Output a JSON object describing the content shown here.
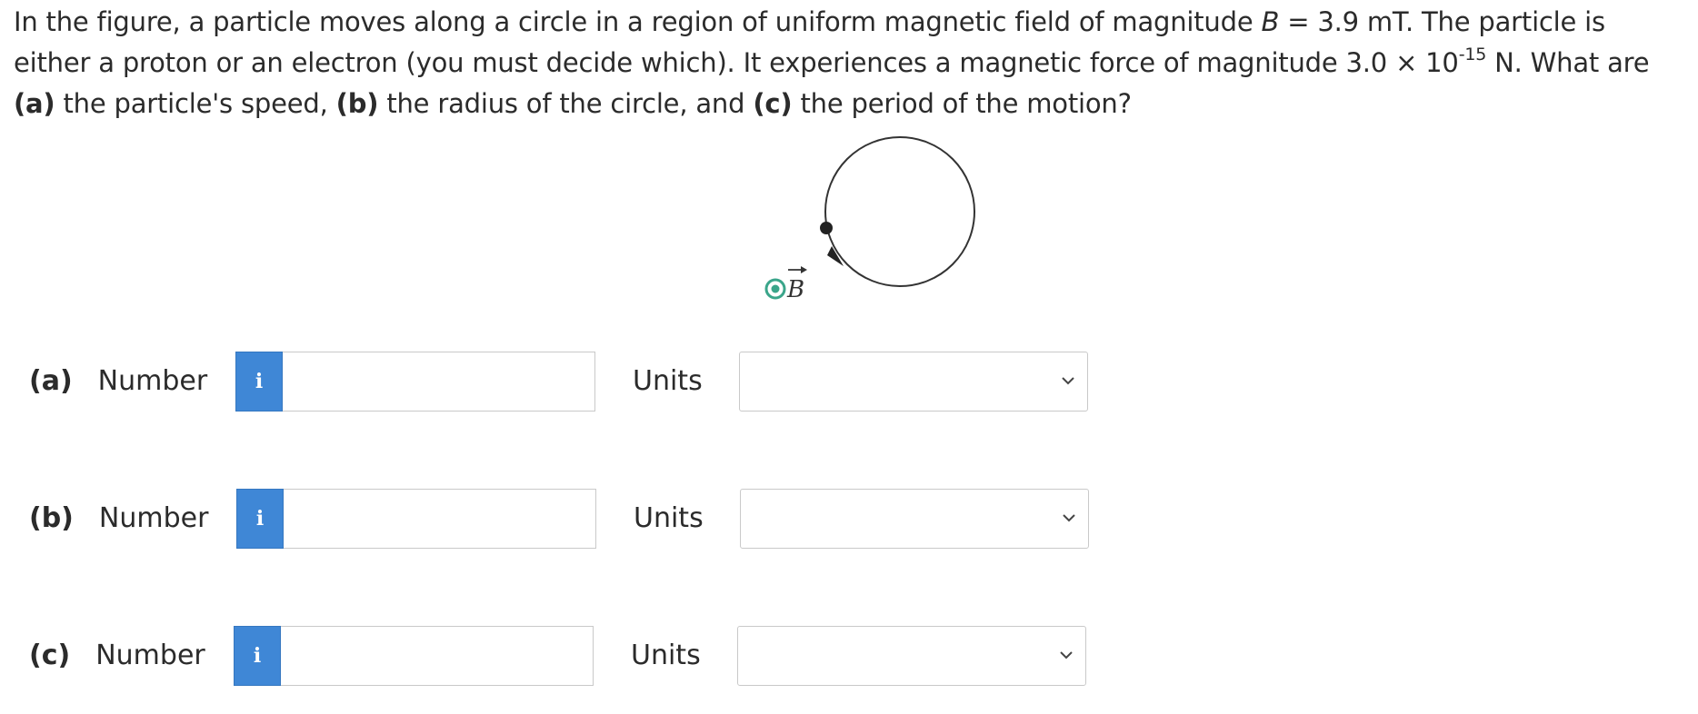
{
  "question": {
    "t1": "In the figure, a particle moves along a circle in a region of uniform magnetic field of magnitude ",
    "b_var": "B",
    "t2": " = 3.9 mT. The particle is either a proton or an electron (you must decide which). It experiences a magnetic force of magnitude 3.0 × 10",
    "exp": "-15",
    "t3": " N. What are ",
    "a_tag": "(a)",
    "t4": " the particle's speed, ",
    "b_tag": "(b)",
    "t5": " the radius of the circle, and ",
    "c_tag": "(c)",
    "t6": " the period of the motion?"
  },
  "figure": {
    "field_symbol": "B",
    "field_color": "#3aa58a"
  },
  "answers": [
    {
      "tag": "(a)",
      "label": "Number",
      "info": "i",
      "value": "",
      "units_label": "Units",
      "units_value": ""
    },
    {
      "tag": "(b)",
      "label": "Number",
      "info": "i",
      "value": "",
      "units_label": "Units",
      "units_value": ""
    },
    {
      "tag": "(c)",
      "label": "Number",
      "info": "i",
      "value": "",
      "units_label": "Units",
      "units_value": ""
    }
  ],
  "colors": {
    "info_button": "#3f87d6"
  }
}
